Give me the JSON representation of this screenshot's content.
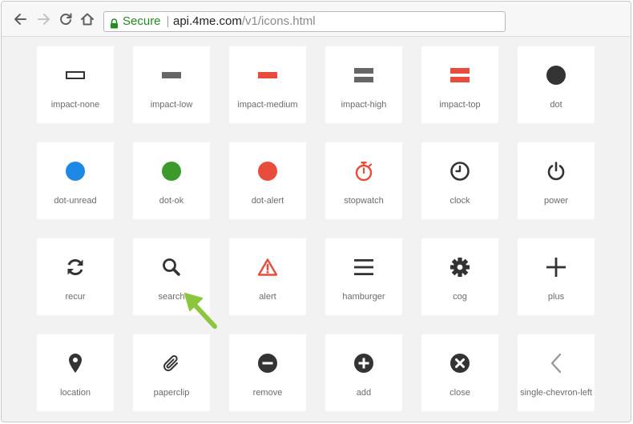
{
  "browser": {
    "secure_label": "Secure",
    "url_host": "api.4me.com",
    "url_path": "/v1/icons.html",
    "icons": [
      "back-arrow-icon",
      "forward-arrow-icon",
      "reload-icon",
      "home-icon",
      "lock-icon"
    ]
  },
  "colors": {
    "dark": "#333333",
    "red": "#e74c3c",
    "blue": "#1e88e5",
    "green": "#3c9a2a",
    "grey": "#999999",
    "arrow": "#8cc63f",
    "secure": "#228b22"
  },
  "icons": [
    {
      "label": "impact-none",
      "icon": "impact-none-icon"
    },
    {
      "label": "impact-low",
      "icon": "impact-low-icon"
    },
    {
      "label": "impact-medium",
      "icon": "impact-medium-icon"
    },
    {
      "label": "impact-high",
      "icon": "impact-high-icon"
    },
    {
      "label": "impact-top",
      "icon": "impact-top-icon"
    },
    {
      "label": "dot",
      "icon": "dot-icon"
    },
    {
      "label": "dot-unread",
      "icon": "dot-unread-icon"
    },
    {
      "label": "dot-ok",
      "icon": "dot-ok-icon"
    },
    {
      "label": "dot-alert",
      "icon": "dot-alert-icon"
    },
    {
      "label": "stopwatch",
      "icon": "stopwatch-icon"
    },
    {
      "label": "clock",
      "icon": "clock-icon"
    },
    {
      "label": "power",
      "icon": "power-icon"
    },
    {
      "label": "recur",
      "icon": "recur-icon"
    },
    {
      "label": "search",
      "icon": "search-icon"
    },
    {
      "label": "alert",
      "icon": "alert-icon"
    },
    {
      "label": "hamburger",
      "icon": "hamburger-icon"
    },
    {
      "label": "cog",
      "icon": "cog-icon"
    },
    {
      "label": "plus",
      "icon": "plus-icon"
    },
    {
      "label": "location",
      "icon": "location-icon"
    },
    {
      "label": "paperclip",
      "icon": "paperclip-icon"
    },
    {
      "label": "remove",
      "icon": "remove-icon"
    },
    {
      "label": "add",
      "icon": "add-icon"
    },
    {
      "label": "close",
      "icon": "close-icon"
    },
    {
      "label": "single-chevron-left",
      "icon": "single-chevron-left-icon"
    }
  ]
}
